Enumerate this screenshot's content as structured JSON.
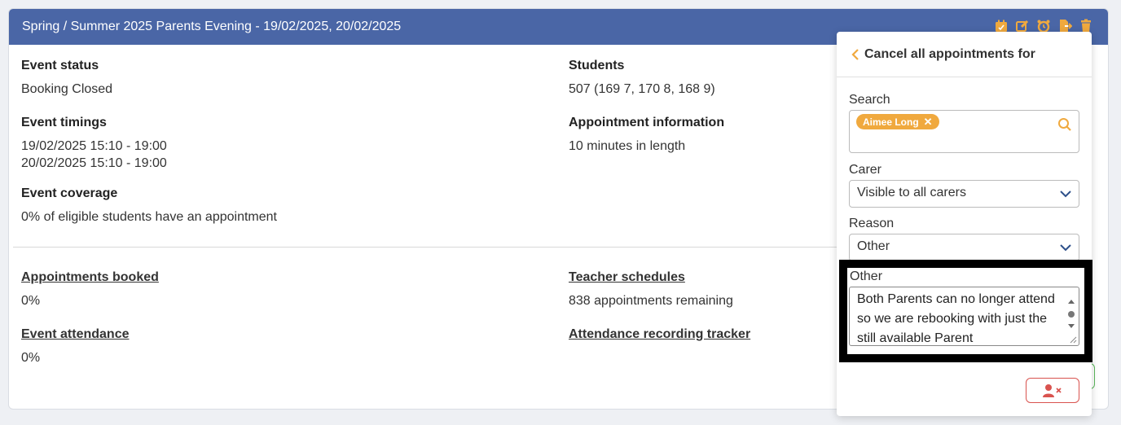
{
  "event": {
    "title": "Spring / Summer 2025 Parents Evening - 19/02/2025, 20/02/2025",
    "status_label": "Event status",
    "status_value": "Booking Closed",
    "timings_label": "Event timings",
    "timings_values": [
      "19/02/2025 15:10 - 19:00",
      "20/02/2025 15:10 - 19:00"
    ],
    "coverage_label": "Event coverage",
    "coverage_value": "0% of eligible students have an appointment",
    "students_label": "Students",
    "students_value": "507 (169 7, 170 8, 168 9)",
    "appt_info_label": "Appointment information",
    "appt_info_value": "10 minutes in length",
    "booked_label": "Appointments booked",
    "booked_value": "0%",
    "attendance_label": "Event attendance",
    "attendance_value": "0%",
    "schedules_label": "Teacher schedules",
    "schedules_value": "838 appointments remaining",
    "tracker_label": "Attendance recording tracker"
  },
  "header_icons": [
    "calendar-icon",
    "edit-icon",
    "alarm-icon",
    "export-icon",
    "trash-icon"
  ],
  "panel": {
    "title": "Cancel all appointments for",
    "search_label": "Search",
    "search_chip": "Aimee Long",
    "carer_label": "Carer",
    "carer_value": "Visible to all carers",
    "reason_label": "Reason",
    "reason_value": "Other",
    "other_label": "Other",
    "other_text": "Both Parents can no longer attend so we are rebooking with just the still available Parent"
  },
  "colors": {
    "header_bg": "#4a66a6",
    "accent": "#f0a93e",
    "danger": "#d9534f"
  }
}
